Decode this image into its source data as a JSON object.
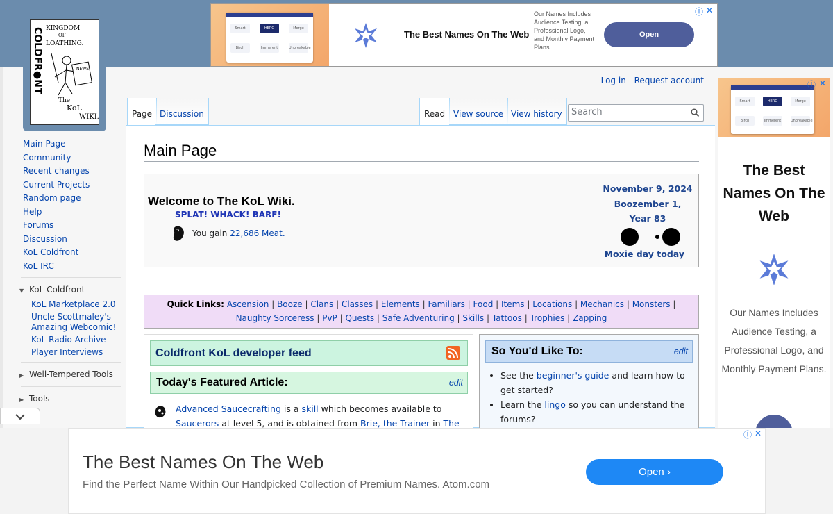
{
  "logo": {
    "alt": "Kingdom of Loathing Coldfront The KoL Wiki"
  },
  "top_ad": {
    "headline": "The Best Names On The Web",
    "description": "Our Names Includes Audience Testing, a Professional Logo, and Monthly Payment Plans.",
    "open_label": "Open",
    "thumb_labels": [
      "Smart",
      "HERO",
      "Merge",
      "Birch",
      "Immerent",
      "Unbreakable"
    ],
    "info_icon": "ⓘ",
    "close_icon": "✕"
  },
  "header": {
    "login": "Log in",
    "request_account": "Request account"
  },
  "tabs": {
    "page": "Page",
    "discussion": "Discussion",
    "read": "Read",
    "view_source": "View source",
    "view_history": "View history"
  },
  "search": {
    "placeholder": "Search"
  },
  "sidebar": {
    "nav": [
      "Main Page",
      "Community",
      "Recent changes",
      "Current Projects",
      "Random page",
      "Help",
      "Forums",
      "Discussion",
      "KoL Coldfront",
      "KoL IRC"
    ],
    "portal_kol": {
      "title": "KoL Coldfront",
      "items": [
        "KoL Marketplace 2.0",
        "Uncle Scottmaley's Amazing Webcomic!",
        "KoL Radio Archive",
        "Player Interviews"
      ]
    },
    "well_tempered": "Well-Tempered Tools",
    "tools": "Tools"
  },
  "main": {
    "title": "Main Page",
    "welcome": {
      "title": "Welcome to The KoL Wiki.",
      "splat": "SPLAT! WHACK! BARF!",
      "gain_prefix": "You gain ",
      "meat_amount": "22,686 Meat.",
      "date": "November 9, 2024",
      "kol_date_1": "Boozember 1,",
      "kol_date_2": "Year 83",
      "moxie": "Moxie day today"
    },
    "quick_links": {
      "label": "Quick Links:",
      "links": [
        "Ascension",
        "Booze",
        "Clans",
        "Classes",
        "Elements",
        "Familiars",
        "Food",
        "Items",
        "Locations",
        "Mechanics",
        "Monsters",
        "Naughty Sorceress",
        "PvP",
        "Quests",
        "Safe Adventuring",
        "Skills",
        "Tattoos",
        "Trophies",
        "Zapping"
      ]
    },
    "feed_title": "Coldfront KoL developer feed",
    "featured": {
      "title": "Today's Featured Article:",
      "edit": "edit",
      "link1": "Advanced Saucecrafting",
      "text1": " is a ",
      "link2": "skill",
      "text2": " which becomes available to",
      "link3": "Saucerors",
      "text3": " at level 5, and is obtained from ",
      "link4": "Brie, the Trainer",
      "text4": " in ",
      "link5": "The"
    },
    "sytd": {
      "title": "So You'd Like To:",
      "edit": "edit",
      "item1_pre": "See the ",
      "item1_link": "beginner's guide",
      "item1_post": " and learn how to get started?",
      "item2_pre": "Learn the ",
      "item2_link": "lingo",
      "item2_post": " so you can understand the forums?"
    }
  },
  "right_ad": {
    "headline": "The Best Names On The Web",
    "description": "Our Names Includes Audience Testing, a Professional Logo, and Monthly Payment Plans.",
    "info_icon": "ⓘ",
    "close_icon": "✕"
  },
  "bottom_ad": {
    "headline": "The Best Names On The Web",
    "description": "Find the Perfect Name Within Our Handpicked Collection of Premium Names. Atom.com",
    "open_label": "Open",
    "info_icon": "ⓘ",
    "close_icon": "✕"
  },
  "colors": {
    "header_band": "#6b8cad",
    "link": "#0645ad",
    "quick_links_bg": "#f0dcf7",
    "feed_bg": "#ccf4e0",
    "sytd_bg": "#c6dcf5",
    "ad_button": "#4f5e9b",
    "bottom_button": "#1e88f5"
  }
}
